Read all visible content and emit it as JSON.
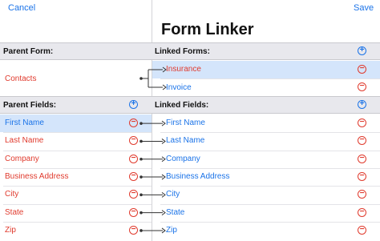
{
  "nav": {
    "cancel": "Cancel",
    "save": "Save",
    "title": "Form Linker"
  },
  "parent_form": {
    "header": "Parent Form:",
    "name": "Contacts"
  },
  "linked_forms": {
    "header": "Linked Forms:",
    "items": [
      {
        "label": "Insurance",
        "selected": true
      },
      {
        "label": "Invoice",
        "selected": false
      }
    ]
  },
  "parent_fields": {
    "header": "Parent Fields:",
    "items": [
      {
        "label": "First Name",
        "selected": true
      },
      {
        "label": "Last Name"
      },
      {
        "label": "Company"
      },
      {
        "label": "Business Address"
      },
      {
        "label": "City"
      },
      {
        "label": "State"
      },
      {
        "label": "Zip"
      }
    ]
  },
  "linked_fields": {
    "header": "Linked Fields:",
    "items": [
      {
        "label": "First Name"
      },
      {
        "label": "Last Name"
      },
      {
        "label": "Company"
      },
      {
        "label": "Business Address"
      },
      {
        "label": "City"
      },
      {
        "label": "State"
      },
      {
        "label": "Zip"
      }
    ]
  },
  "colors": {
    "accent": "#1a73e8",
    "destructive": "#e03a2d",
    "selection": "#d4e5fb"
  },
  "icons": {
    "add": "plus-circle-icon",
    "remove": "minus-circle-icon"
  }
}
